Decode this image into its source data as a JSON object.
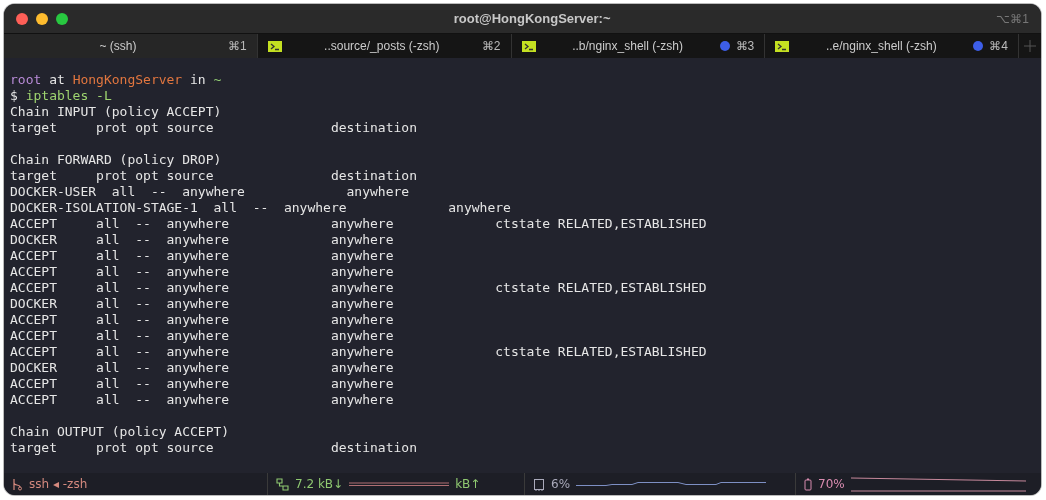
{
  "window": {
    "title": "root@HongKongServer:~",
    "shortcut": "⌥⌘1"
  },
  "tabs": [
    {
      "label": "~ (ssh)",
      "shortcut": "⌘1",
      "selected": true,
      "icon": false,
      "activity": false
    },
    {
      "label": "..source/_posts (-zsh)",
      "shortcut": "⌘2",
      "selected": false,
      "icon": true,
      "activity": false
    },
    {
      "label": "..b/nginx_shell (-zsh)",
      "shortcut": "⌘3",
      "selected": false,
      "icon": true,
      "activity": true
    },
    {
      "label": "..e/nginx_shell (-zsh)",
      "shortcut": "⌘4",
      "selected": false,
      "icon": true,
      "activity": true
    }
  ],
  "terminal": {
    "lines": [
      {
        "kind": "prompt",
        "user": "root",
        "at": "at",
        "host": "HongKongServer",
        "in": "in",
        "dir": "~"
      },
      {
        "kind": "command",
        "symbol": "$",
        "text": "iptables -L"
      },
      {
        "kind": "output",
        "text": "Chain INPUT (policy ACCEPT)"
      },
      {
        "kind": "output",
        "text": "target     prot opt source               destination"
      },
      {
        "kind": "blank"
      },
      {
        "kind": "output",
        "text": "Chain FORWARD (policy DROP)"
      },
      {
        "kind": "output",
        "text": "target     prot opt source               destination"
      },
      {
        "kind": "output",
        "text": "DOCKER-USER  all  --  anywhere             anywhere"
      },
      {
        "kind": "output",
        "text": "DOCKER-ISOLATION-STAGE-1  all  --  anywhere             anywhere"
      },
      {
        "kind": "output",
        "text": "ACCEPT     all  --  anywhere             anywhere             ctstate RELATED,ESTABLISHED"
      },
      {
        "kind": "output",
        "text": "DOCKER     all  --  anywhere             anywhere"
      },
      {
        "kind": "output",
        "text": "ACCEPT     all  --  anywhere             anywhere"
      },
      {
        "kind": "output",
        "text": "ACCEPT     all  --  anywhere             anywhere"
      },
      {
        "kind": "output",
        "text": "ACCEPT     all  --  anywhere             anywhere             ctstate RELATED,ESTABLISHED"
      },
      {
        "kind": "output",
        "text": "DOCKER     all  --  anywhere             anywhere"
      },
      {
        "kind": "output",
        "text": "ACCEPT     all  --  anywhere             anywhere"
      },
      {
        "kind": "output",
        "text": "ACCEPT     all  --  anywhere             anywhere"
      },
      {
        "kind": "output",
        "text": "ACCEPT     all  --  anywhere             anywhere             ctstate RELATED,ESTABLISHED"
      },
      {
        "kind": "output",
        "text": "DOCKER     all  --  anywhere             anywhere"
      },
      {
        "kind": "output",
        "text": "ACCEPT     all  --  anywhere             anywhere"
      },
      {
        "kind": "output",
        "text": "ACCEPT     all  --  anywhere             anywhere"
      },
      {
        "kind": "blank"
      },
      {
        "kind": "output",
        "text": "Chain OUTPUT (policy ACCEPT)"
      },
      {
        "kind": "output",
        "text": "target     prot opt source               destination"
      }
    ]
  },
  "status_bar": {
    "session": "ssh ◂ -zsh",
    "download": "7.2 kB↓",
    "upload": "kB↑",
    "cpu": "6%",
    "battery": "70%"
  }
}
